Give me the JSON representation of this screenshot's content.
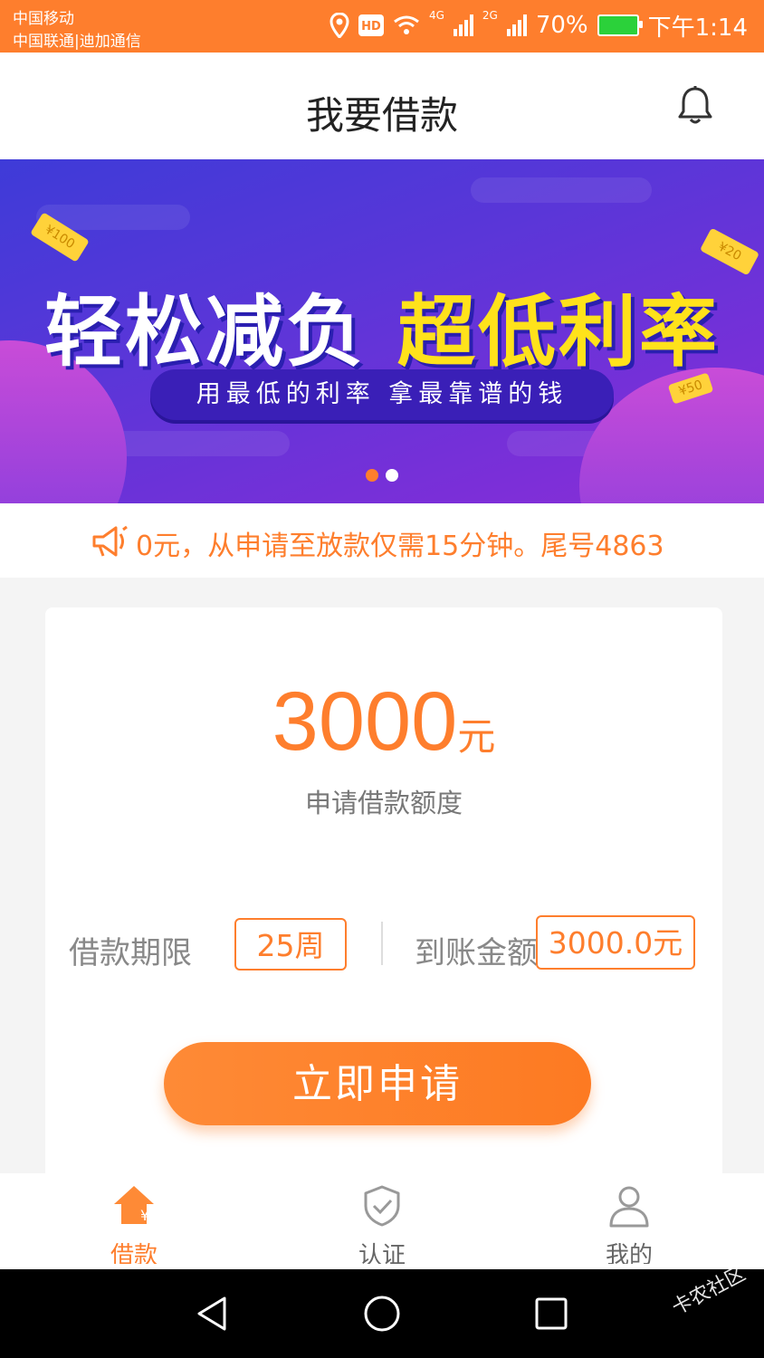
{
  "status_bar": {
    "carrier_1": "中国移动",
    "carrier_2": "中国联通|迪加通信",
    "net_1": "4G",
    "net_2": "2G",
    "battery": "70%",
    "time": "下午1:14",
    "icons": [
      "location-icon",
      "hd-icon",
      "wifi-icon",
      "signal-icon",
      "battery-icon"
    ]
  },
  "header": {
    "title": "我要借款",
    "bell_icon": "bell-icon"
  },
  "banner": {
    "headline_white": "轻松减负",
    "headline_yellow": "超低利率",
    "subtitle": "用最低的利率 拿最靠谱的钱",
    "ticket_1": "¥100",
    "ticket_2": "¥20",
    "ticket_3": "¥50",
    "page_count": 2,
    "active_page": 1
  },
  "notice": {
    "text": "0元，从申请至放款仅需15分钟。尾号4863"
  },
  "loan": {
    "amount": "3000",
    "unit": "元",
    "amount_label": "申请借款额度",
    "term_label": "借款期限",
    "term_value": "25周",
    "received_label": "到账金额",
    "received_value": "3000.0元",
    "apply_button": "立即申请"
  },
  "tabbar": {
    "tabs": [
      {
        "label": "借款",
        "icon": "loan-home-icon",
        "active": true
      },
      {
        "label": "认证",
        "icon": "shield-check-icon",
        "active": false
      },
      {
        "label": "我的",
        "icon": "user-icon",
        "active": false
      }
    ]
  },
  "navbar": {
    "watermark": "卡农社区"
  },
  "colors": {
    "accent": "#fe7e2d",
    "banner_bg": "#5a36d8",
    "banner_yellow": "#ffe21b"
  }
}
